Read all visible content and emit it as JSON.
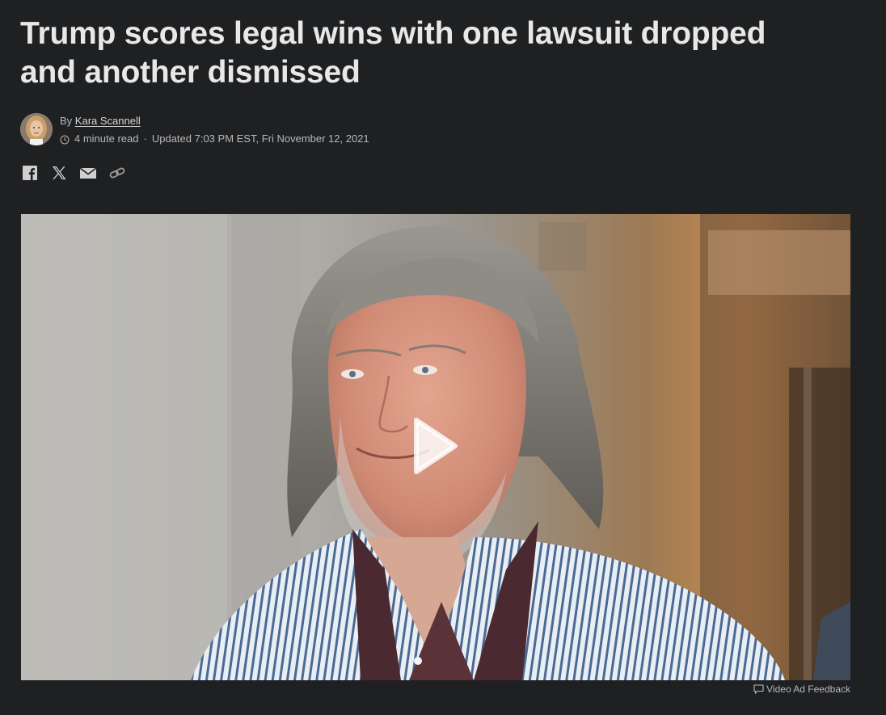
{
  "article": {
    "headline": "Trump scores legal wins with one lawsuit dropped and another dismissed",
    "byline_prefix": "By",
    "author": "Kara Scannell",
    "read_time": "4 minute read",
    "separator": "·",
    "updated": "Updated 7:03 PM EST, Fri November 12, 2021"
  },
  "share": {
    "icons": [
      "facebook-icon",
      "x-icon",
      "email-icon",
      "link-icon"
    ]
  },
  "media": {
    "type": "video",
    "feedback_label": "Video Ad Feedback"
  },
  "colors": {
    "background": "#1f2022",
    "headline": "#e8e8e8",
    "meta_text": "#b8b8b8"
  }
}
